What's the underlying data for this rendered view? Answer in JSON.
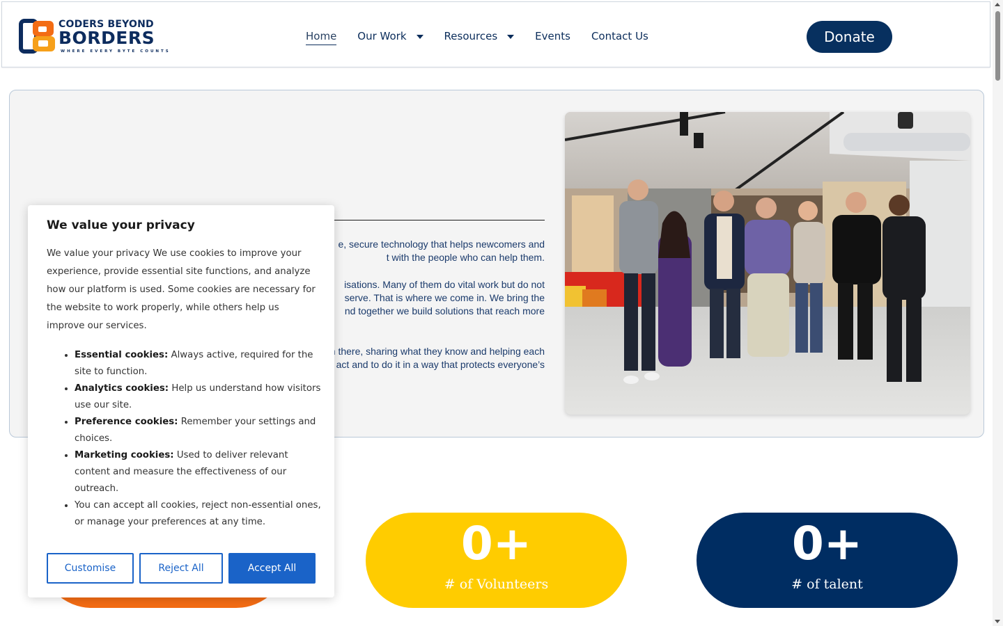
{
  "header": {
    "logo": {
      "line1": "CODERS BEYOND",
      "line2": "BORDERS",
      "tagline": "WHERE EVERY BYTE COUNTS"
    },
    "nav": [
      {
        "label": "Home",
        "active": true,
        "has_dropdown": false
      },
      {
        "label": "Our Work",
        "active": false,
        "has_dropdown": true
      },
      {
        "label": "Resources",
        "active": false,
        "has_dropdown": true
      },
      {
        "label": "Events",
        "active": false,
        "has_dropdown": false
      },
      {
        "label": "Contact Us",
        "active": false,
        "has_dropdown": false
      }
    ],
    "donate_label": "Donate"
  },
  "hero": {
    "paragraph_lines": [
      "e, secure technology that helps newcomers and",
      "t with the people who can help them.",
      "isations. Many of them do vital work but do not",
      "serve. That is where we come in. We bring the",
      "nd together we build solutions that reach more",
      "n there, sharing what they know and helping each",
      "act and to do it in a way that protects everyone’s"
    ]
  },
  "stats": [
    {
      "value": "0+",
      "label": "# of Volunteers",
      "color": "#ffcc00"
    },
    {
      "value": "0+",
      "label": "# of talent",
      "color": "#002d62"
    }
  ],
  "cookie": {
    "title": "We value your privacy",
    "body": "We value your privacy We use cookies to improve your experience, provide essential site functions, and analyze how our platform is used. Some cookies are necessary for the website to work properly, while others help us improve our services.",
    "items": [
      {
        "term": "Essential cookies:",
        "text": " Always active, required for the site to function."
      },
      {
        "term": "Analytics cookies:",
        "text": " Help us understand how visitors use our site."
      },
      {
        "term": "Preference cookies:",
        "text": " Remember your settings and choices."
      },
      {
        "term": "Marketing cookies:",
        "text": " Used to deliver relevant content and measure the effectiveness of our outreach."
      },
      {
        "term": "",
        "text": "You can accept all cookies, reject non-essential ones, or manage your preferences at any time."
      }
    ],
    "buttons": {
      "customise": "Customise",
      "reject": "Reject All",
      "accept": "Accept All"
    }
  },
  "colors": {
    "brand_navy": "#07305f",
    "brand_orange": "#f36c14",
    "brand_yellow": "#ffcc00",
    "cookie_accent": "#1a63c8"
  }
}
